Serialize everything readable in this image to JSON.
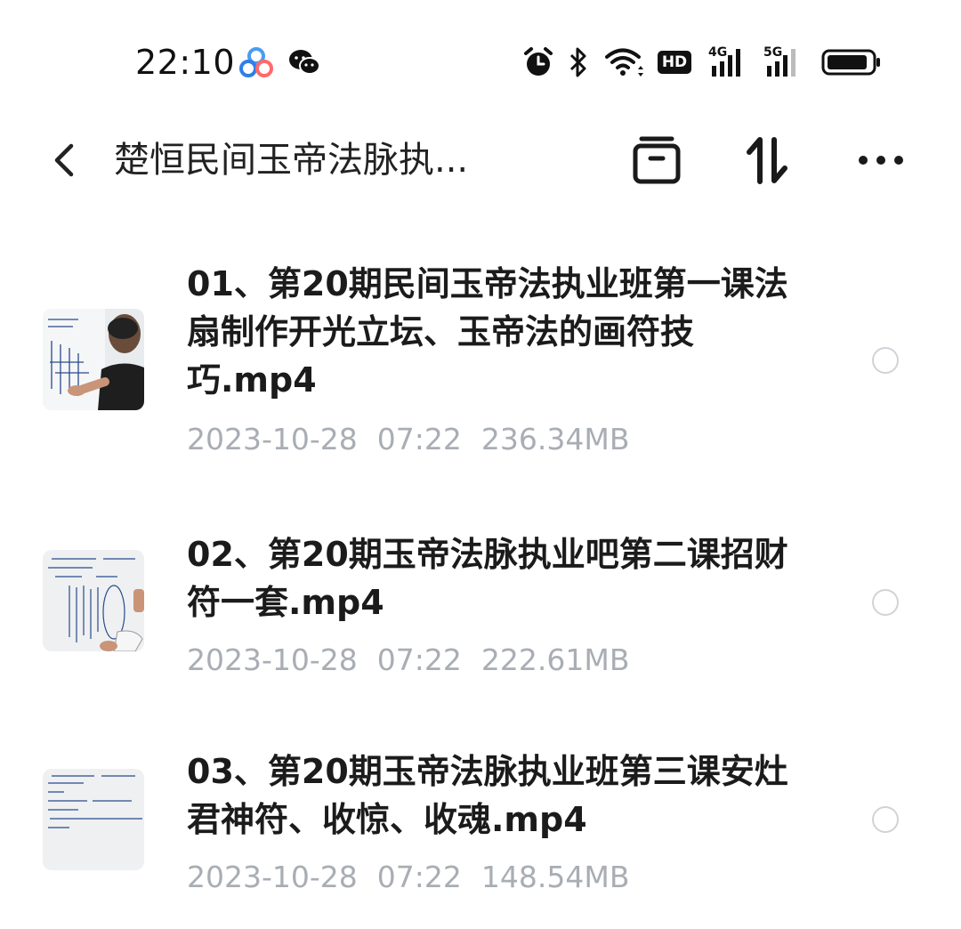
{
  "status_bar": {
    "time": "22:10",
    "icons": [
      "baidu-netdisk-icon",
      "wechat-icon",
      "alarm-icon",
      "bluetooth-icon",
      "wifi-icon",
      "hd-icon",
      "signal-4g-icon",
      "signal-5g-icon",
      "battery-icon"
    ],
    "hd_label": "HD",
    "net1": "4G",
    "net2": "5G"
  },
  "header": {
    "title": "楚恒民间玉帝法脉执...",
    "actions": [
      "select-all-icon",
      "sort-icon",
      "more-icon"
    ]
  },
  "files": [
    {
      "name": "01、第20期民间玉帝法执业班第一课法扇制作开光立坛、玉帝法的画符技巧.mp4",
      "date": "2023-10-28",
      "time": "07:22",
      "size": "236.34MB"
    },
    {
      "name": "02、第20期玉帝法脉执业吧第二课招财符一套.mp4",
      "date": "2023-10-28",
      "time": "07:22",
      "size": "222.61MB"
    },
    {
      "name": "03、第20期玉帝法脉执业班第三课安灶君神符、收惊、收魂.mp4",
      "date": "2023-10-28",
      "time": "07:22",
      "size": "148.54MB"
    }
  ],
  "colors": {
    "meta_text": "#a9adb4",
    "title_text": "#222222",
    "radio_border": "#d0d3d7"
  }
}
